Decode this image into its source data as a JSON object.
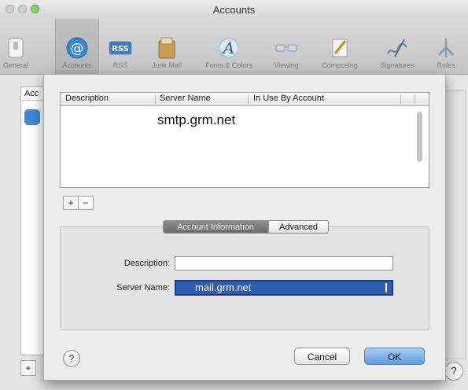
{
  "window": {
    "title": "Accounts"
  },
  "toolbar": {
    "items": [
      {
        "label": "General",
        "icon": "general-switch-icon"
      },
      {
        "label": "Accounts",
        "icon": "at-sign-icon"
      },
      {
        "label": "RSS",
        "icon": "rss-icon"
      },
      {
        "label": "Junk Mail",
        "icon": "junk-mail-bin-icon"
      },
      {
        "label": "Fonts & Colors",
        "icon": "fonts-colors-icon"
      },
      {
        "label": "Viewing",
        "icon": "glasses-icon"
      },
      {
        "label": "Composing",
        "icon": "pencil-paper-icon"
      },
      {
        "label": "Signatures",
        "icon": "signature-pen-icon"
      },
      {
        "label": "Rules",
        "icon": "rules-icon"
      }
    ],
    "selected": "Accounts",
    "rss_badge": "RSS",
    "fonts_glyph": "A"
  },
  "background": {
    "list_header": "Acc",
    "add_label": "+",
    "help_label": "?"
  },
  "sheet": {
    "table": {
      "columns": [
        "Description",
        "Server Name",
        "In Use By Account"
      ],
      "rows": [
        {
          "description": "",
          "server_name": "smtp.grm.net",
          "in_use": ""
        }
      ]
    },
    "add_button": "+",
    "remove_button": "−",
    "tabs": [
      "Account Information",
      "Advanced"
    ],
    "active_tab": "Account Information",
    "fields": {
      "description": {
        "label": "Description:",
        "value": ""
      },
      "server_name": {
        "label": "Server Name:",
        "value": "mail.grm.net"
      }
    },
    "help_label": "?",
    "cancel_label": "Cancel",
    "ok_label": "OK"
  }
}
